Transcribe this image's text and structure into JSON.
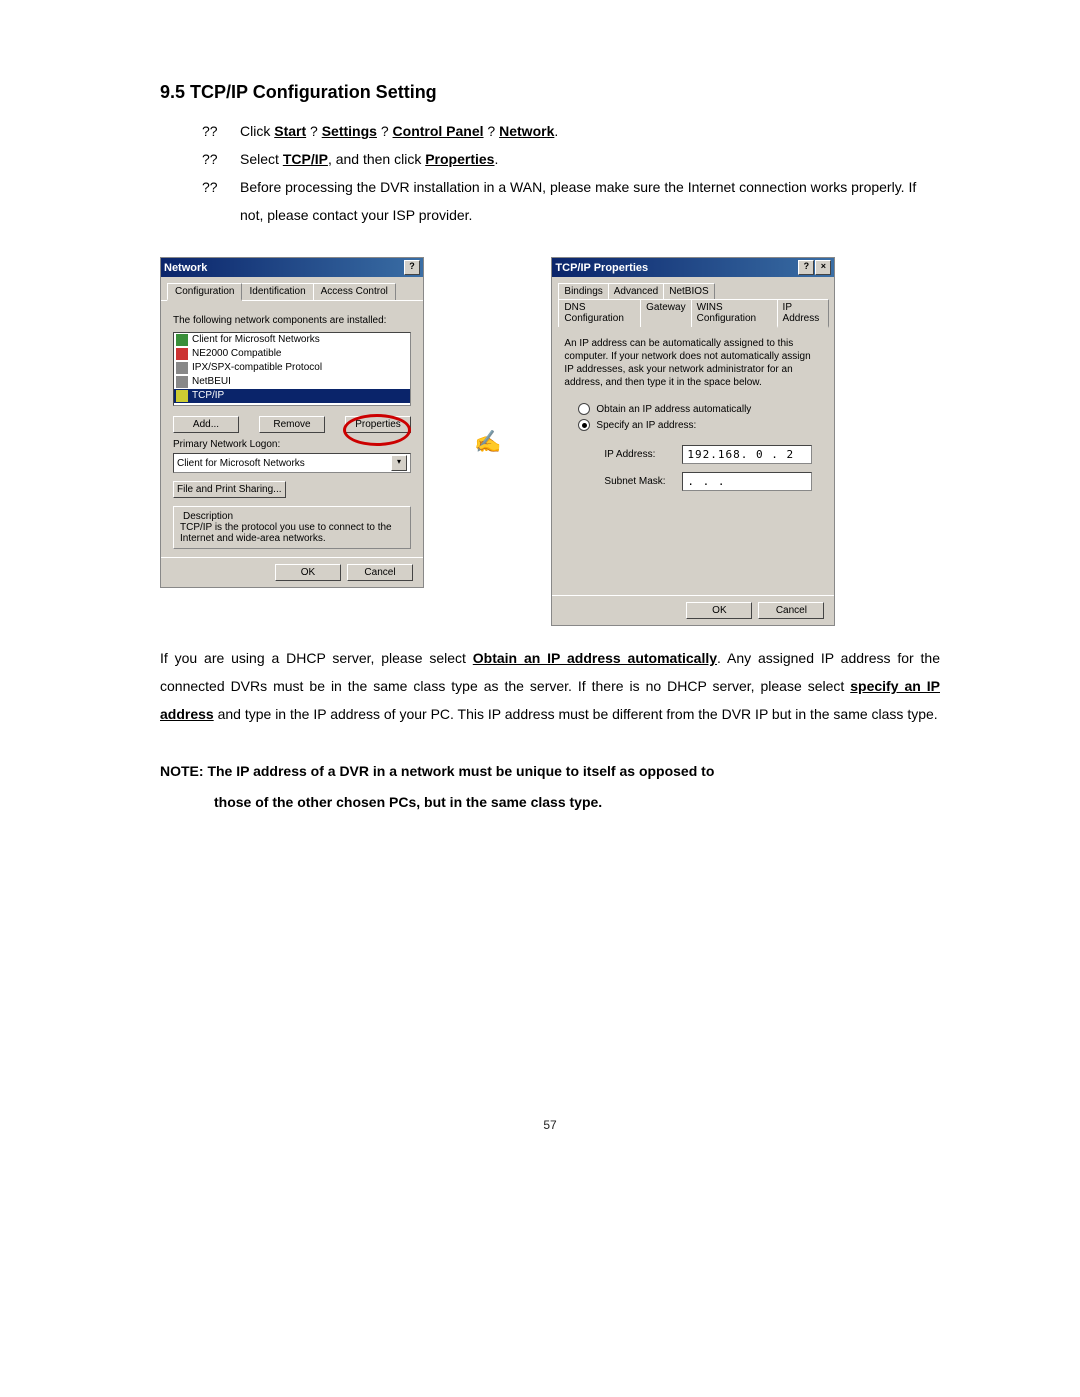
{
  "heading": "9.5 TCP/IP Configuration Setting",
  "steps": {
    "bullet": "??",
    "s1_pre": "Click ",
    "s1_b1": "Start",
    "s1_a1": " ? ",
    "s1_b2": "Settings",
    "s1_a2": " ? ",
    "s1_b3": "Control Panel",
    "s1_a3": " ? ",
    "s1_b4": "Network",
    "s1_end": ".",
    "s2_pre": "Select ",
    "s2_b1": "TCP/IP",
    "s2_mid": ", and then click ",
    "s2_b2": "Properties",
    "s2_end": ".",
    "s3": "Before processing the DVR installation in a WAN, please make sure the Internet connection works properly. If not, please contact your ISP provider."
  },
  "win1": {
    "title": "Network",
    "help": "?",
    "close": "×",
    "tabs": {
      "t1": "Configuration",
      "t2": "Identification",
      "t3": "Access Control"
    },
    "intro": "The following network components are installed:",
    "items": {
      "i1": "Client for Microsoft Networks",
      "i2": "NE2000 Compatible",
      "i3": "IPX/SPX-compatible Protocol",
      "i4": "NetBEUI",
      "i5": "TCP/IP"
    },
    "btns": {
      "add": "Add...",
      "remove": "Remove",
      "props": "Properties"
    },
    "logon_lbl": "Primary Network Logon:",
    "logon_val": "Client for Microsoft Networks",
    "fps": "File and Print Sharing...",
    "desc_lbl": "Description",
    "desc": "TCP/IP is the protocol you use to connect to the Internet and wide-area networks.",
    "ok": "OK",
    "cancel": "Cancel"
  },
  "pencil": "✍",
  "win2": {
    "title": "TCP/IP Properties",
    "help": "?",
    "close": "×",
    "tabs": {
      "t1": "Bindings",
      "t2": "Advanced",
      "t3": "NetBIOS",
      "t4": "DNS Configuration",
      "t5": "Gateway",
      "t6": "WINS Configuration",
      "t7": "IP Address"
    },
    "intro": "An IP address can be automatically assigned to this computer. If your network does not automatically assign IP addresses, ask your network administrator for an address, and then type it in the space below.",
    "r1": "Obtain an IP address automatically",
    "r2": "Specify an IP address:",
    "ip_lbl": "IP Address:",
    "ip_val": "192.168. 0 . 2",
    "mask_lbl": "Subnet Mask:",
    "mask_val": " .   .   . ",
    "ok": "OK",
    "cancel": "Cancel"
  },
  "para": {
    "p1": "If you are using a DHCP server, please select ",
    "u1": "Obtain an IP address automatically",
    "p2": ". Any assigned IP address for the connected DVRs must be in the same class type as the server. If there is no DHCP server, please select ",
    "u2": "specify an IP address",
    "p3": " and type in the IP address of your PC. This IP address must be different from the DVR IP but in the same class type."
  },
  "note": {
    "n1": "NOTE: The IP address of a DVR in a network must be unique to itself as opposed to",
    "n2": "those of the other chosen PCs, but in the same class type."
  },
  "pagenum": "57"
}
